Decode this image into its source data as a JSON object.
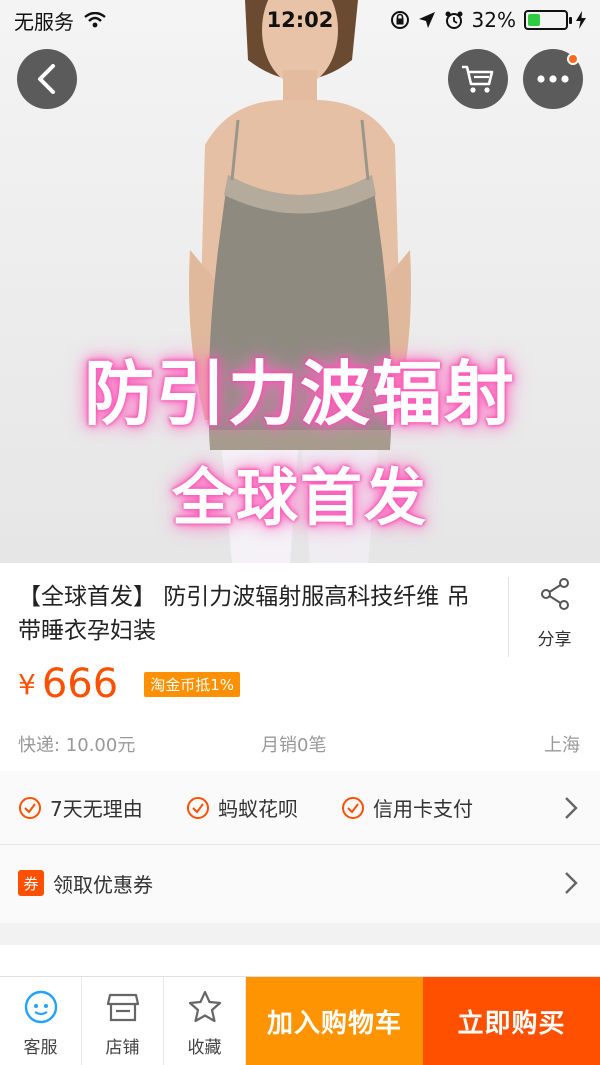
{
  "status_bar": {
    "carrier": "无服务",
    "time": "12:02",
    "battery_percent": "32%",
    "battery_level": 0.32,
    "battery_color": "#2ecc40"
  },
  "header_buttons": {
    "back_icon": "chevron-left-icon",
    "cart_icon": "cart-icon",
    "more_icon": "more-dots-icon"
  },
  "hero": {
    "promo_line1": "防引力波辐射",
    "promo_line2": "全球首发"
  },
  "product": {
    "title": "【全球首发】 防引力波辐射服高科技纤维 吊带睡衣孕妇装",
    "share_label": "分享",
    "currency_symbol": "¥",
    "price": "666",
    "coin_tag": "淘金币抵1%",
    "shipping": "快递: 10.00元",
    "monthly_sales": "月销0笔",
    "location": "上海"
  },
  "services": {
    "items": [
      "7天无理由",
      "蚂蚁花呗",
      "信用卡支付"
    ],
    "coupon_badge": "券",
    "coupon_text": "领取优惠券"
  },
  "bottom_bar": {
    "tools": [
      {
        "label": "客服",
        "icon": "customer-service-icon"
      },
      {
        "label": "店铺",
        "icon": "shop-icon"
      },
      {
        "label": "收藏",
        "icon": "star-icon"
      }
    ],
    "add_to_cart": "加入购物车",
    "buy_now": "立即购买"
  },
  "colors": {
    "accent": "#ff5000",
    "cart_orange": "#ff9402",
    "coin_orange": "#ff9000",
    "promo_glow": "#ff57b8"
  }
}
